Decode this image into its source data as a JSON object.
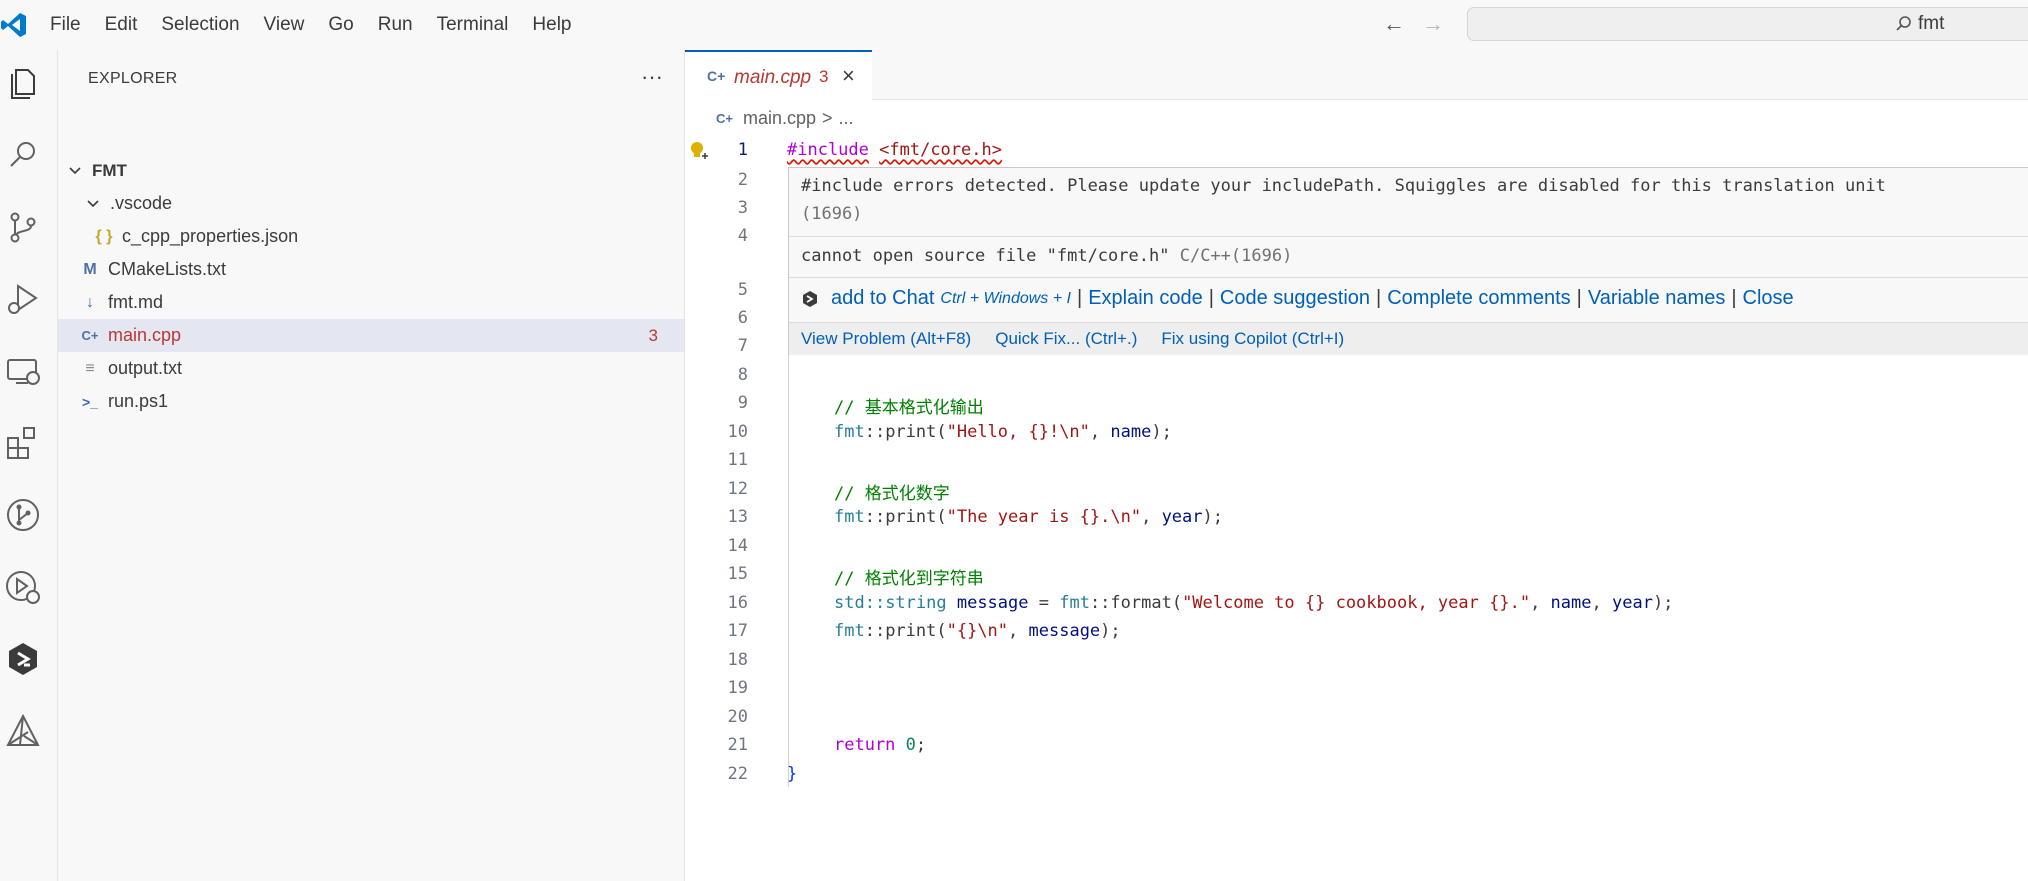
{
  "menu": [
    "File",
    "Edit",
    "Selection",
    "View",
    "Go",
    "Run",
    "Terminal",
    "Help"
  ],
  "search": {
    "text": "fmt"
  },
  "activity_icons": [
    "explorer-icon",
    "search-icon",
    "source-control-icon",
    "run-debug-icon",
    "remote-explorer-icon",
    "extensions-icon",
    "git-graph-icon",
    "testing-icon",
    "copilot-icon",
    "cmake-icon"
  ],
  "sidebar": {
    "title": "EXPLORER",
    "more": "···",
    "root": "FMT",
    "items": [
      {
        "label": ".vscode",
        "icon": "chevron-down-icon"
      },
      {
        "label": "c_cpp_properties.json",
        "icon": "json-icon",
        "glyph": "{ }"
      },
      {
        "label": "CMakeLists.txt",
        "icon": "cmake-file-icon",
        "glyph": "M"
      },
      {
        "label": "fmt.md",
        "icon": "markdown-icon",
        "glyph": "↓"
      },
      {
        "label": "main.cpp",
        "icon": "cpp-icon",
        "glyph": "C+",
        "badge": "3"
      },
      {
        "label": "output.txt",
        "icon": "text-file-icon",
        "glyph": "≡"
      },
      {
        "label": "run.ps1",
        "icon": "powershell-icon",
        "glyph": ">_"
      }
    ]
  },
  "tab": {
    "name": "main.cpp",
    "count": "3",
    "close": "×"
  },
  "breadcrumb": {
    "file": "main.cpp",
    "sep": ">",
    "rest": "..."
  },
  "line_numbers": [
    "1",
    "2",
    "3",
    "4",
    "5",
    "6",
    "7",
    "8",
    "9",
    "10",
    "11",
    "12",
    "13",
    "14",
    "15",
    "16",
    "17",
    "18",
    "19",
    "20",
    "21",
    "22"
  ],
  "code": {
    "line1_directive": "#include",
    "line1_header": "<fmt/core.h>",
    "line9": "// 基本格式化输出",
    "line10_ns": "fmt",
    "line10_fn": "::print(",
    "line10_str": "\"Hello, {}!\\n\"",
    "line10_rest": ", ",
    "line10_var": "name",
    "line10_end": ");",
    "line12": "// 格式化数字",
    "line13_ns": "fmt",
    "line13_fn": "::print(",
    "line13_str": "\"The year is {}.\\n\"",
    "line13_rest": ", ",
    "line13_var": "year",
    "line13_end": ");",
    "line15": "// 格式化到字符串",
    "line16_ns": "std",
    "line16_type": "::string ",
    "line16_var": "message",
    "line16_eq": " = ",
    "line16_ns2": "fmt",
    "line16_fn": "::format(",
    "line16_str": "\"Welcome to {} cookbook, year {}.\"",
    "line16_c1": ", ",
    "line16_v1": "name",
    "line16_c2": ", ",
    "line16_v2": "year",
    "line16_end": ");",
    "line17_ns": "fmt",
    "line17_fn": "::print(",
    "line17_str": "\"{}\\n\"",
    "line17_rest": ", ",
    "line17_var": "message",
    "line17_end": ");",
    "line21_kw": "return",
    "line21_num": "0",
    "line21_end": ";",
    "line22": "}"
  },
  "hover": {
    "message1": "#include errors detected. Please update your includePath. Squiggles are disabled for this translation unit",
    "code1": "(1696)",
    "message2": "cannot open source file \"fmt/core.h\"",
    "source2": "C/C++(1696)",
    "actions": {
      "add_to_chat": "add to Chat",
      "add_to_chat_kbd": "Ctrl + Windows + I",
      "explain": "Explain code",
      "suggest": "Code suggestion",
      "comments": "Complete comments",
      "varnames": "Variable names",
      "close": "Close"
    },
    "bar": {
      "view_problem": "View Problem (Alt+F8)",
      "quick_fix": "Quick Fix... (Ctrl+.)",
      "fix_copilot": "Fix using Copilot (Ctrl+I)"
    }
  },
  "colors": {
    "accent": "#005fb8",
    "error": "#b8392f",
    "selection": "#e4e6f1"
  }
}
